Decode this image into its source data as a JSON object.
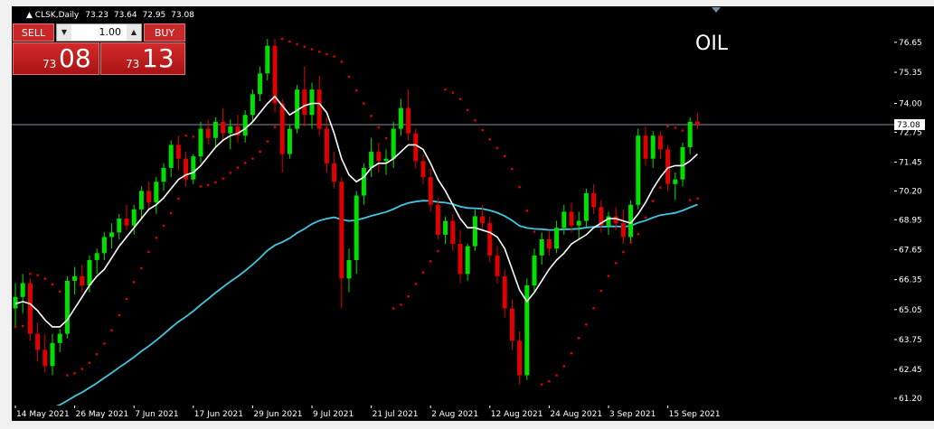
{
  "chart_title": "CLSK,Daily",
  "ohlc": {
    "open": "73.23",
    "high": "73.64",
    "low": "72.95",
    "close": "73.08"
  },
  "watermark_label": "OIL",
  "trade_panel": {
    "sell_label": "SELL",
    "buy_label": "BUY",
    "lot_value": "1.00",
    "sell_price_prefix": "73",
    "sell_price_main": "08",
    "buy_price_prefix": "73",
    "buy_price_main": "13"
  },
  "current_price_label": "73.08",
  "colors": {
    "background": "#000000",
    "bull_candle": "#00e000",
    "bear_candle": "#e00000",
    "fast_ma": "#ffffff",
    "slow_ma": "#40c8e0",
    "parabolic_sar": "#e00000",
    "price_line": "#8a8aa0",
    "axis_text": "#ffffff"
  },
  "chart_data": {
    "type": "candlestick",
    "symbol": "CLSK",
    "timeframe": "Daily",
    "ylim": [
      61.2,
      77.9
    ],
    "y_ticks": [
      "76.65",
      "75.35",
      "74.00",
      "72.75",
      "71.45",
      "70.20",
      "68.95",
      "67.65",
      "66.35",
      "65.05",
      "63.75",
      "62.45",
      "61.20"
    ],
    "x_tick_labels": [
      {
        "label": "14 May 2021",
        "index": 0
      },
      {
        "label": "26 May 2021",
        "index": 8
      },
      {
        "label": "7 Jun 2021",
        "index": 16
      },
      {
        "label": "17 Jun 2021",
        "index": 24
      },
      {
        "label": "29 Jun 2021",
        "index": 32
      },
      {
        "label": "9 Jul 2021",
        "index": 40
      },
      {
        "label": "21 Jul 2021",
        "index": 48
      },
      {
        "label": "2 Aug 2021",
        "index": 56
      },
      {
        "label": "12 Aug 2021",
        "index": 64
      },
      {
        "label": "24 Aug 2021",
        "index": 72
      },
      {
        "label": "3 Sep 2021",
        "index": 80
      },
      {
        "label": "15 Sep 2021",
        "index": 88
      }
    ],
    "current_price": 73.08,
    "candles": [
      [
        65.1,
        66.2,
        64.3,
        65.6
      ],
      [
        65.6,
        66.6,
        64.9,
        66.2
      ],
      [
        66.2,
        66.4,
        63.7,
        64.0
      ],
      [
        64.0,
        64.5,
        62.8,
        63.3
      ],
      [
        63.3,
        64.0,
        62.3,
        62.6
      ],
      [
        62.6,
        64.0,
        62.2,
        63.6
      ],
      [
        63.6,
        64.2,
        63.2,
        64.0
      ],
      [
        64.0,
        66.5,
        63.8,
        66.3
      ],
      [
        66.3,
        66.9,
        65.7,
        66.5
      ],
      [
        66.5,
        67.0,
        65.8,
        66.1
      ],
      [
        66.1,
        67.4,
        65.8,
        67.2
      ],
      [
        67.2,
        67.7,
        66.6,
        67.5
      ],
      [
        67.5,
        68.4,
        67.2,
        68.2
      ],
      [
        68.2,
        68.8,
        67.7,
        68.4
      ],
      [
        68.4,
        69.2,
        68.1,
        69.0
      ],
      [
        69.0,
        69.6,
        68.5,
        68.7
      ],
      [
        68.7,
        69.6,
        68.3,
        69.4
      ],
      [
        69.4,
        70.4,
        69.0,
        70.2
      ],
      [
        70.2,
        70.6,
        69.4,
        69.7
      ],
      [
        69.7,
        70.8,
        69.2,
        70.6
      ],
      [
        70.6,
        71.4,
        70.2,
        71.2
      ],
      [
        71.2,
        72.4,
        70.8,
        72.2
      ],
      [
        72.2,
        72.6,
        71.1,
        71.6
      ],
      [
        71.6,
        71.9,
        70.4,
        70.7
      ],
      [
        70.7,
        71.8,
        70.5,
        71.7
      ],
      [
        71.7,
        73.2,
        71.4,
        72.9
      ],
      [
        72.9,
        73.3,
        72.2,
        72.5
      ],
      [
        72.5,
        73.4,
        72.1,
        73.2
      ],
      [
        73.2,
        73.8,
        72.4,
        72.7
      ],
      [
        72.7,
        73.3,
        72.0,
        73.0
      ],
      [
        73.0,
        73.5,
        72.3,
        72.6
      ],
      [
        72.6,
        73.7,
        72.3,
        73.5
      ],
      [
        73.5,
        74.6,
        73.2,
        74.4
      ],
      [
        74.4,
        75.6,
        74.1,
        75.3
      ],
      [
        75.3,
        76.8,
        75.0,
        76.5
      ],
      [
        76.5,
        76.8,
        73.6,
        74.0
      ],
      [
        74.0,
        74.2,
        71.0,
        71.8
      ],
      [
        71.8,
        73.1,
        71.6,
        72.9
      ],
      [
        72.9,
        74.8,
        72.7,
        74.6
      ],
      [
        74.6,
        75.6,
        73.0,
        73.5
      ],
      [
        73.5,
        74.9,
        72.9,
        74.6
      ],
      [
        74.6,
        75.2,
        72.6,
        72.9
      ],
      [
        72.9,
        73.4,
        71.0,
        71.4
      ],
      [
        71.4,
        71.9,
        70.3,
        70.6
      ],
      [
        70.6,
        70.8,
        65.1,
        66.4
      ],
      [
        66.4,
        67.7,
        65.8,
        67.2
      ],
      [
        67.2,
        70.2,
        66.6,
        70.0
      ],
      [
        70.0,
        71.4,
        69.6,
        71.2
      ],
      [
        71.2,
        72.5,
        70.8,
        71.9
      ],
      [
        71.9,
        72.3,
        71.0,
        71.5
      ],
      [
        71.5,
        72.0,
        70.9,
        71.6
      ],
      [
        71.6,
        73.2,
        71.2,
        72.9
      ],
      [
        72.9,
        74.2,
        72.6,
        73.8
      ],
      [
        73.8,
        74.6,
        72.4,
        72.7
      ],
      [
        72.7,
        72.9,
        71.2,
        71.5
      ],
      [
        71.5,
        71.8,
        70.5,
        70.8
      ],
      [
        70.8,
        71.2,
        69.3,
        69.6
      ],
      [
        69.6,
        69.9,
        68.1,
        68.3
      ],
      [
        68.3,
        69.1,
        67.9,
        68.9
      ],
      [
        68.9,
        69.2,
        67.6,
        67.9
      ],
      [
        67.9,
        68.5,
        66.2,
        66.6
      ],
      [
        66.6,
        67.9,
        66.3,
        67.8
      ],
      [
        67.8,
        69.4,
        67.6,
        69.1
      ],
      [
        69.1,
        69.6,
        68.5,
        68.8
      ],
      [
        68.8,
        69.1,
        67.1,
        67.4
      ],
      [
        67.4,
        67.8,
        66.2,
        66.5
      ],
      [
        66.5,
        66.8,
        64.7,
        65.1
      ],
      [
        65.1,
        65.5,
        63.3,
        63.7
      ],
      [
        63.7,
        64.1,
        61.8,
        62.2
      ],
      [
        62.2,
        66.4,
        62.0,
        66.1
      ],
      [
        66.1,
        67.7,
        65.8,
        67.4
      ],
      [
        67.4,
        68.4,
        67.0,
        68.1
      ],
      [
        68.1,
        68.5,
        67.4,
        67.7
      ],
      [
        67.7,
        68.9,
        67.5,
        68.6
      ],
      [
        68.6,
        69.6,
        68.3,
        69.3
      ],
      [
        69.3,
        69.7,
        68.4,
        68.7
      ],
      [
        68.7,
        69.3,
        68.1,
        68.9
      ],
      [
        68.9,
        70.3,
        68.6,
        70.1
      ],
      [
        70.1,
        70.5,
        69.2,
        69.5
      ],
      [
        69.5,
        69.8,
        68.4,
        68.7
      ],
      [
        68.7,
        69.3,
        68.3,
        69.1
      ],
      [
        69.1,
        69.5,
        68.5,
        68.8
      ],
      [
        68.8,
        69.4,
        67.9,
        68.2
      ],
      [
        68.2,
        69.8,
        68.0,
        69.6
      ],
      [
        69.6,
        72.9,
        69.4,
        72.6
      ],
      [
        72.6,
        73.0,
        71.3,
        71.6
      ],
      [
        71.6,
        72.8,
        71.2,
        72.6
      ],
      [
        72.6,
        72.8,
        71.6,
        72.0
      ],
      [
        72.0,
        72.2,
        70.2,
        70.5
      ],
      [
        70.5,
        71.0,
        69.8,
        70.7
      ],
      [
        70.7,
        72.3,
        70.4,
        72.1
      ],
      [
        72.1,
        73.4,
        71.8,
        73.2
      ],
      [
        73.2,
        73.6,
        72.9,
        73.08
      ]
    ],
    "fast_ma": [
      65.3,
      65.4,
      65.3,
      65.0,
      64.6,
      64.3,
      64.3,
      64.6,
      65.1,
      65.6,
      66.1,
      66.5,
      66.8,
      67.3,
      67.8,
      68.2,
      68.6,
      69.0,
      69.4,
      69.6,
      69.9,
      70.3,
      70.7,
      70.9,
      71.0,
      71.3,
      71.7,
      72.1,
      72.4,
      72.6,
      72.7,
      72.9,
      73.2,
      73.6,
      74.0,
      74.3,
      73.9,
      73.5,
      73.7,
      73.9,
      74.0,
      74.0,
      73.6,
      72.7,
      71.6,
      70.9,
      70.6,
      70.8,
      71.2,
      71.4,
      71.4,
      71.6,
      71.9,
      72.2,
      72.2,
      72.0,
      71.4,
      70.7,
      70.2,
      69.6,
      69.0,
      68.6,
      68.6,
      68.5,
      68.4,
      68.2,
      67.7,
      66.8,
      65.9,
      65.4,
      65.8,
      66.3,
      66.8,
      67.2,
      67.5,
      67.9,
      68.1,
      68.3,
      68.6,
      68.8,
      69.0,
      69.0,
      68.9,
      68.8,
      69.2,
      69.7,
      70.3,
      70.8,
      71.2,
      71.3,
      71.3,
      71.5,
      71.8
    ]
  }
}
